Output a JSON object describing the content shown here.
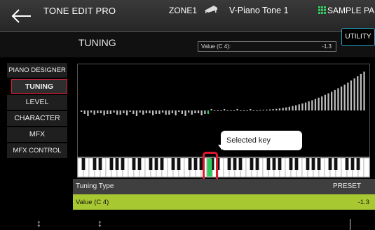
{
  "header": {
    "app_title": "TONE EDIT PRO",
    "zone": "ZONE1",
    "tone_name": "V-Piano Tone  1",
    "sample_pad": "SAMPLE PAD",
    "icons": [
      "back-arrow-icon",
      "piano-tone-icon",
      "sample-pad-grid-icon"
    ],
    "accent_color": "#2ec95a"
  },
  "subheader": {
    "title": "TUNING",
    "value_label": "Value  (C 4):",
    "value": "-1.3",
    "utility_label": "UTILITY"
  },
  "menu": {
    "items": [
      {
        "label": "PIANO DESIGNER",
        "selected": false
      },
      {
        "label": "TUNING",
        "selected": true
      },
      {
        "label": "LEVEL",
        "selected": false
      },
      {
        "label": "CHARACTER",
        "selected": false
      },
      {
        "label": "MFX",
        "selected": false
      },
      {
        "label": "MFX CONTROL",
        "selected": false
      }
    ],
    "selected_color": "#d9213a"
  },
  "graph": {
    "selected_key_index": 39,
    "key_count": 88,
    "callout": "Selected key",
    "selected_color": "#2ec95a"
  },
  "params": {
    "type_label": "Tuning Type",
    "type_value": "PRESET",
    "value_label": "Value  (C 4)",
    "value": "-1.3",
    "value_row_color": "#a8c832"
  },
  "footer": {
    "knob1": "↕",
    "knob2": "↕"
  }
}
